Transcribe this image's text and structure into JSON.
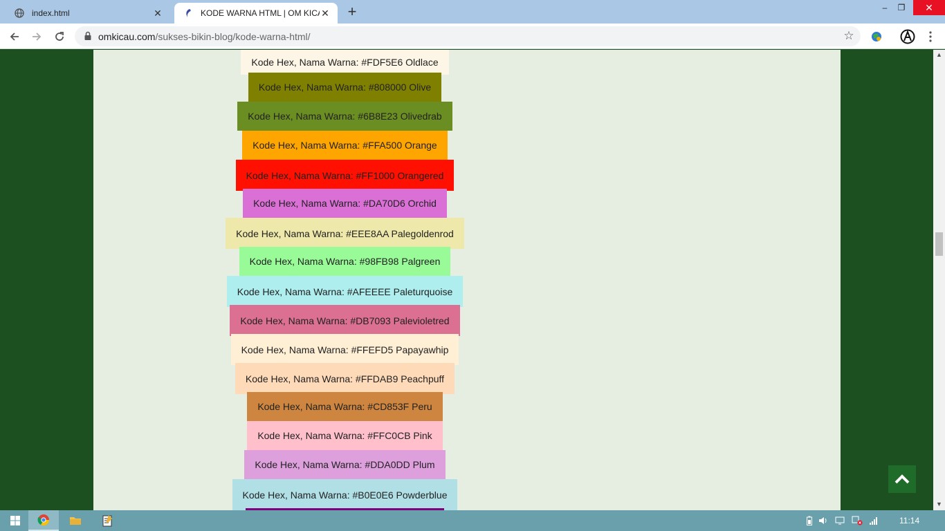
{
  "browser": {
    "tabs": [
      {
        "title": "index.html",
        "icon": "globe-icon"
      },
      {
        "title": "KODE WARNA HTML | OM KICAU",
        "icon": "site-favicon-icon"
      }
    ],
    "new_tab_symbol": "+",
    "window_controls": {
      "minimize": "–",
      "maximize": "❐",
      "close": "✕"
    },
    "address": {
      "domain": "omkicau.com",
      "path": "/sukses-bikin-blog/kode-warna-html/"
    }
  },
  "page": {
    "colors": [
      {
        "label": "Kode Hex, Nama Warna: #FDF5E6 Oldlace",
        "bg": "#FDF5E6",
        "fg": "#222222"
      },
      {
        "label": "Kode Hex, Nama Warna: #808000 Olive",
        "bg": "#808000",
        "fg": "#222222"
      },
      {
        "label": "Kode Hex, Nama Warna: #6B8E23 Olivedrab",
        "bg": "#6B8E23",
        "fg": "#222222"
      },
      {
        "label": "Kode Hex, Nama Warna: #FFA500 Orange",
        "bg": "#FFA500",
        "fg": "#222222"
      },
      {
        "label": "Kode Hex, Nama Warna: #FF1000 Orangered",
        "bg": "#FF1000",
        "fg": "#222222"
      },
      {
        "label": "Kode Hex, Nama Warna: #DA70D6 Orchid",
        "bg": "#DA70D6",
        "fg": "#222222"
      },
      {
        "label": "Kode Hex, Nama Warna: #EEE8AA Palegoldenrod",
        "bg": "#EEE8AA",
        "fg": "#222222"
      },
      {
        "label": "Kode Hex, Nama Warna: #98FB98 Palgreen",
        "bg": "#98FB98",
        "fg": "#222222"
      },
      {
        "label": "Kode Hex, Nama Warna: #AFEEEE Paleturquoise",
        "bg": "#AFEEEE",
        "fg": "#222222"
      },
      {
        "label": "Kode Hex, Nama Warna: #DB7093 Palevioletred",
        "bg": "#DB7093",
        "fg": "#222222"
      },
      {
        "label": "Kode Hex, Nama Warna: #FFEFD5 Papayawhip",
        "bg": "#FFEFD5",
        "fg": "#222222"
      },
      {
        "label": "Kode Hex, Nama Warna: #FFDAB9 Peachpuff",
        "bg": "#FFDAB9",
        "fg": "#222222"
      },
      {
        "label": "Kode Hex, Nama Warna: #CD853F Peru",
        "bg": "#CD853F",
        "fg": "#222222"
      },
      {
        "label": "Kode Hex, Nama Warna: #FFC0CB Pink",
        "bg": "#FFC0CB",
        "fg": "#222222"
      },
      {
        "label": "Kode Hex, Nama Warna: #DDA0DD Plum",
        "bg": "#DDA0DD",
        "fg": "#222222"
      },
      {
        "label": "Kode Hex, Nama Warna: #B0E0E6 Powderblue",
        "bg": "#B0E0E6",
        "fg": "#222222"
      },
      {
        "label": "",
        "bg": "#800080",
        "fg": "#222222"
      }
    ],
    "back_to_top_icon": "chevron-up-icon",
    "colors_theme": {
      "page_bg": "#1C5020",
      "content_bg": "#E6EEE2",
      "back_to_top_bg": "#1F6B29"
    }
  },
  "taskbar": {
    "clock": "11:14"
  }
}
